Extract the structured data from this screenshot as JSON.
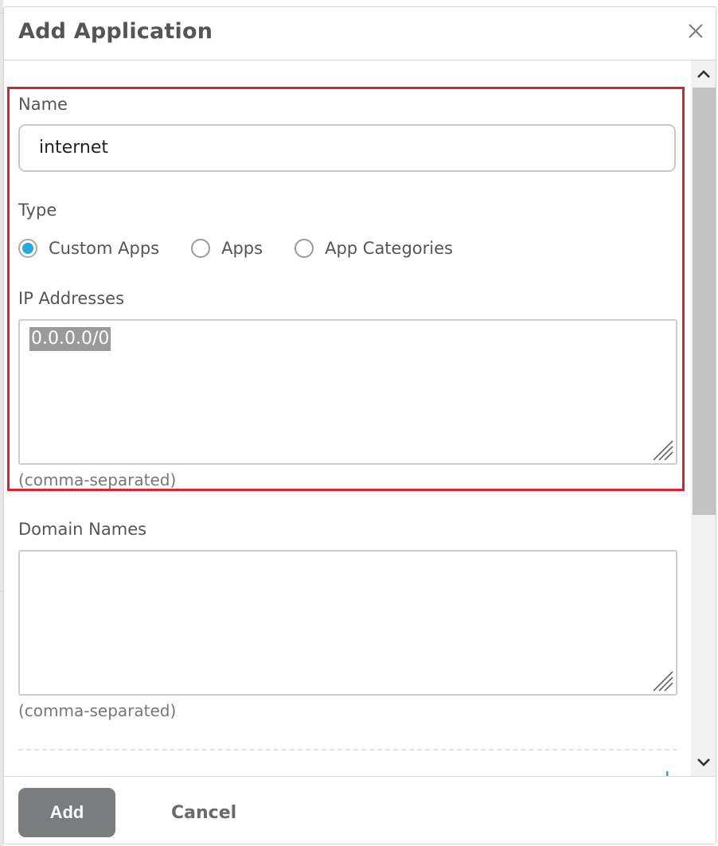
{
  "dialog": {
    "title": "Add Application",
    "close_icon": "close-icon"
  },
  "form": {
    "name": {
      "label": "Name",
      "value": "internet"
    },
    "type": {
      "label": "Type",
      "options": [
        {
          "label": "Custom Apps",
          "checked": true
        },
        {
          "label": "Apps",
          "checked": false
        },
        {
          "label": "App Categories",
          "checked": false
        }
      ]
    },
    "ip_addresses": {
      "label": "IP Addresses",
      "value": "0.0.0.0/0",
      "hint": "(comma-separated)"
    },
    "domain_names": {
      "label": "Domain Names",
      "value": "",
      "hint": "(comma-separated)"
    }
  },
  "footer": {
    "add_label": "Add",
    "cancel_label": "Cancel"
  },
  "colors": {
    "highlight": "#d9232d",
    "radio_selected": "#29a8df",
    "primary_button": "#7b7c7e",
    "add_icon": "#29a8df"
  }
}
